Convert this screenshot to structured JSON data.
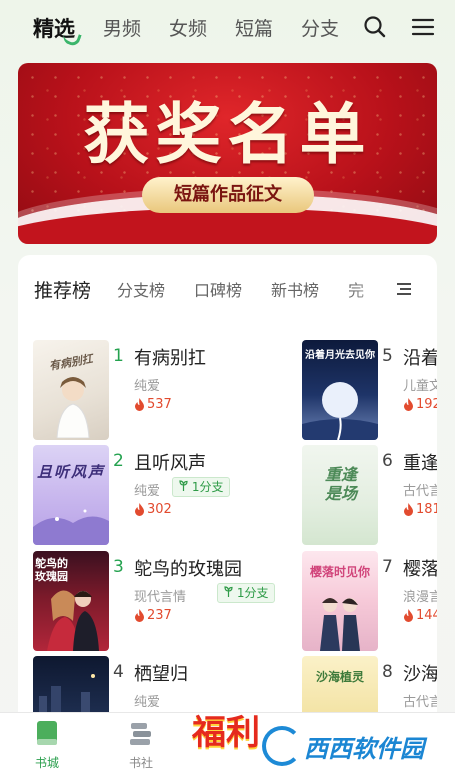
{
  "top_nav": {
    "tabs": [
      "精选",
      "男频",
      "女频",
      "短篇",
      "分支"
    ],
    "active_index": 0,
    "icons": [
      "search-icon",
      "menu-icon"
    ]
  },
  "banner": {
    "title": "获奖名单",
    "subtitle": "短篇作品征文",
    "colors": {
      "background": "#c2141d",
      "title": "#fff6dc",
      "pill": "#e9c77c"
    }
  },
  "rank_tabs": [
    "推荐榜",
    "分支榜",
    "口碑榜",
    "新书榜",
    "完"
  ],
  "books_left": [
    {
      "rank": "1",
      "title": "有病别扛",
      "category": "纯爱",
      "branch": "",
      "hot": "537",
      "cover_text": "有病别扛"
    },
    {
      "rank": "2",
      "title": "且听风声",
      "category": "纯爱",
      "branch": "1分支",
      "hot": "302",
      "cover_text": "且听风声"
    },
    {
      "rank": "3",
      "title": "鸵鸟的玫瑰园",
      "category": "现代言情",
      "branch": "1分支",
      "hot": "237",
      "cover_text": "鸵鸟的玫瑰园"
    },
    {
      "rank": "4",
      "title": "栖望归",
      "category": "纯爱",
      "branch": "",
      "hot": "",
      "cover_text": ""
    }
  ],
  "books_right": [
    {
      "rank": "5",
      "title": "沿着",
      "category": "儿童文",
      "hot": "192",
      "cover_text": "沿着月光去见你"
    },
    {
      "rank": "6",
      "title": "重逢",
      "category": "古代言",
      "hot": "181",
      "cover_text": "重逢是场"
    },
    {
      "rank": "7",
      "title": "樱落",
      "category": "浪漫言",
      "hot": "144",
      "cover_text": "樱落时见你"
    },
    {
      "rank": "8",
      "title": "沙海",
      "category": "古代言",
      "hot": "",
      "cover_text": "沙海植灵"
    }
  ],
  "bottom_bar": {
    "items": [
      "书城",
      "书社"
    ],
    "active_index": 0,
    "promo": "福利"
  },
  "watermark": {
    "text": "西西软件园"
  }
}
